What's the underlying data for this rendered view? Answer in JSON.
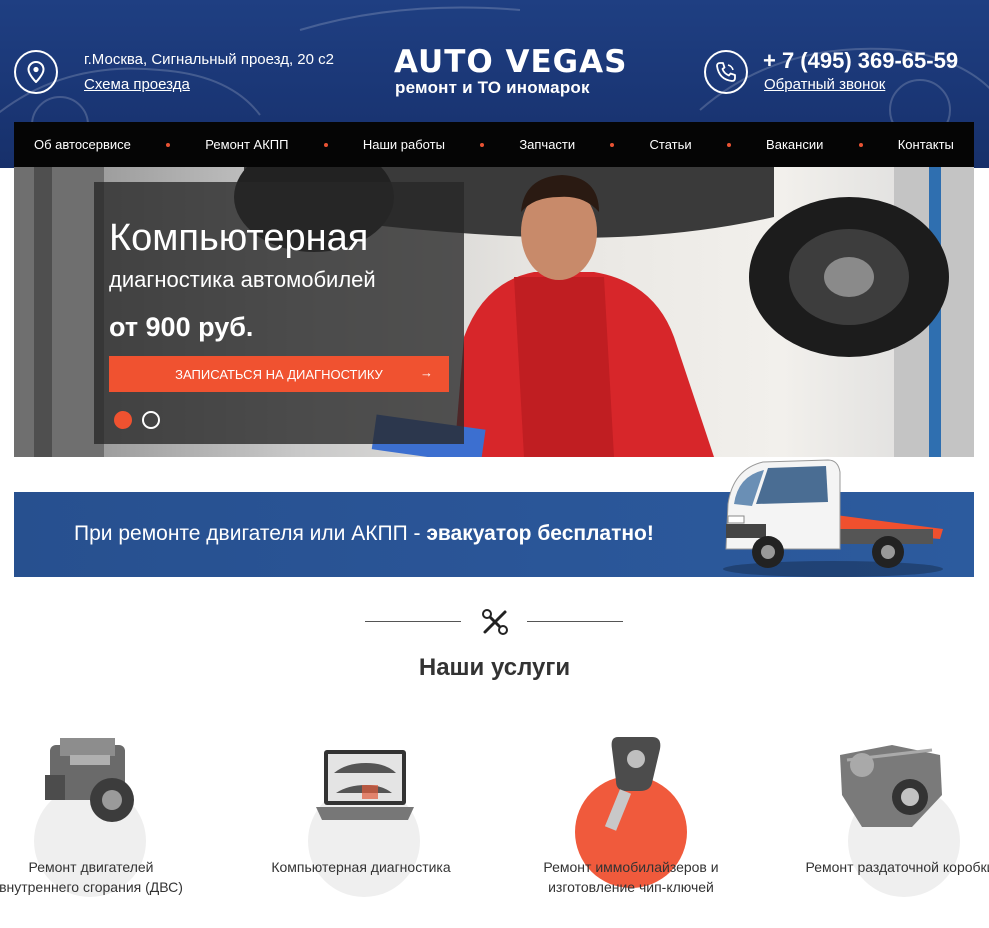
{
  "header": {
    "address": "г.Москва, Сигнальный проезд, 20 с2",
    "route_link": "Схема проезда",
    "logo_top": "AUTO VEGAS",
    "logo_sub": "ремонт и ТО иномарок",
    "phone": "+ 7 (495) 369-65-59",
    "callback_link": "Обратный звонок"
  },
  "nav": {
    "items": [
      {
        "label": "Об автосервисе"
      },
      {
        "label": "Ремонт АКПП"
      },
      {
        "label": "Наши работы"
      },
      {
        "label": "Запчасти"
      },
      {
        "label": "Статьи"
      },
      {
        "label": "Вакансии"
      },
      {
        "label": "Контакты"
      }
    ]
  },
  "hero": {
    "title": "Компьютерная",
    "subtitle": "диагностика автомобилей",
    "price": "от 900 руб.",
    "button": "ЗАПИСАТЬСЯ НА ДИАГНОСТИКУ",
    "arrow": "→"
  },
  "banner": {
    "text": "При ремонте двигателя или АКПП - ",
    "text_bold": "эвакуатор бесплатно!"
  },
  "services": {
    "title": "Наши услуги",
    "items": [
      {
        "label": "Ремонт двигателей внутреннего сгорания (ДВС)"
      },
      {
        "label": "Компьютерная диагностика"
      },
      {
        "label": "Ремонт иммобилайзеров и изготовление чип-ключей"
      },
      {
        "label": "Ремонт раздаточной коробки"
      }
    ]
  },
  "colors": {
    "accent": "#f05230",
    "header_blue": "#1f3f82",
    "nav_bg": "#050505",
    "banner_blue": "#2a5597"
  }
}
